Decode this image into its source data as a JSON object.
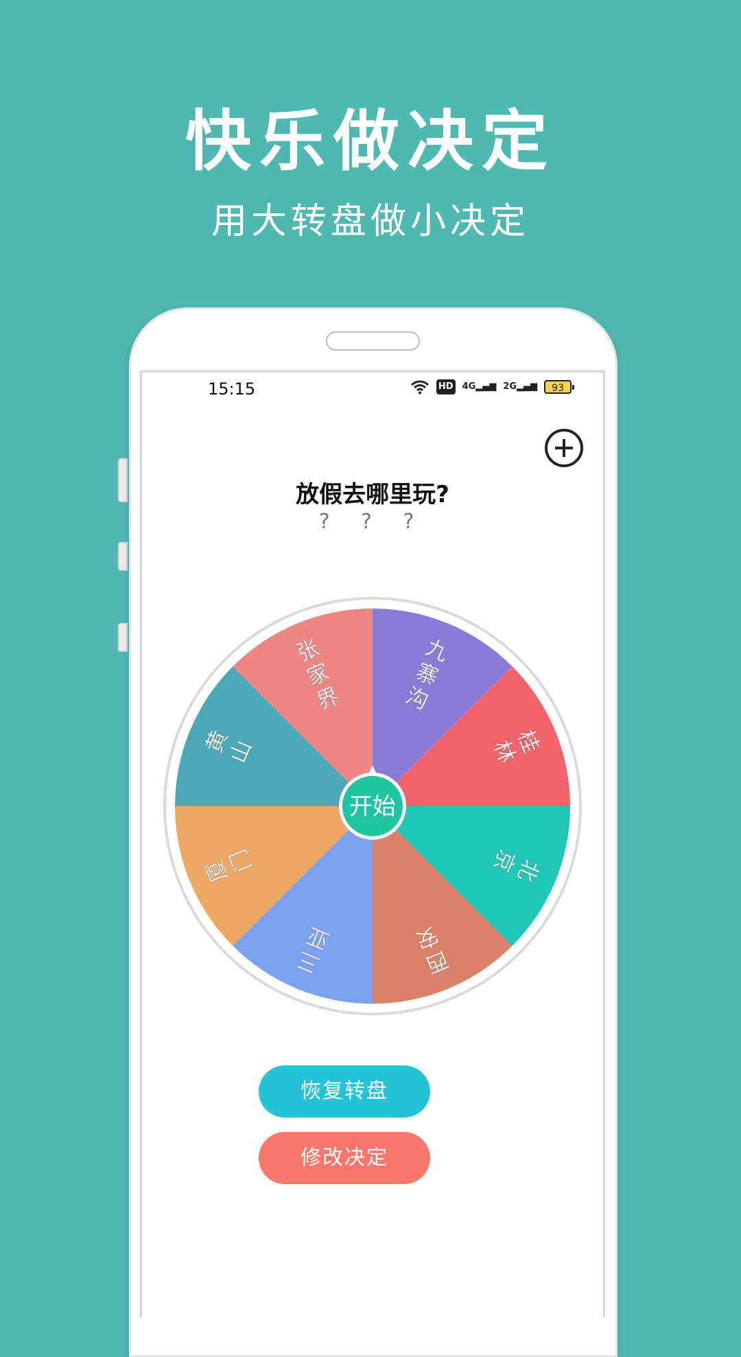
{
  "promo": {
    "title": "快乐做决定",
    "subtitle": "用大转盘做小决定"
  },
  "status_bar": {
    "time": "15:15",
    "hd_label": "HD",
    "net1": "4G",
    "net2": "2G",
    "battery": "93"
  },
  "question": "放假去哪里玩?",
  "answer_placeholder": "? ? ?",
  "start_label": "开始",
  "wheel_segments": [
    {
      "label": "九寨沟",
      "color": "#8b7bd8"
    },
    {
      "label": "桂林",
      "color": "#f2636b"
    },
    {
      "label": "北京",
      "color": "#20c7b8"
    },
    {
      "label": "西安",
      "color": "#dc806a"
    },
    {
      "label": "三亚",
      "color": "#7ba1f0"
    },
    {
      "label": "厦门",
      "color": "#eda964"
    },
    {
      "label": "黄山",
      "color": "#4ba9b7"
    },
    {
      "label": "张家界",
      "color": "#ec8783"
    }
  ],
  "buttons": {
    "restore_label": "恢复转盘",
    "modify_label": "修改决定"
  },
  "colors": {
    "background": "#4fb8b0",
    "start_button": "#1fc5a1",
    "restore_button": "#24c3d6",
    "modify_button": "#f7776a"
  }
}
